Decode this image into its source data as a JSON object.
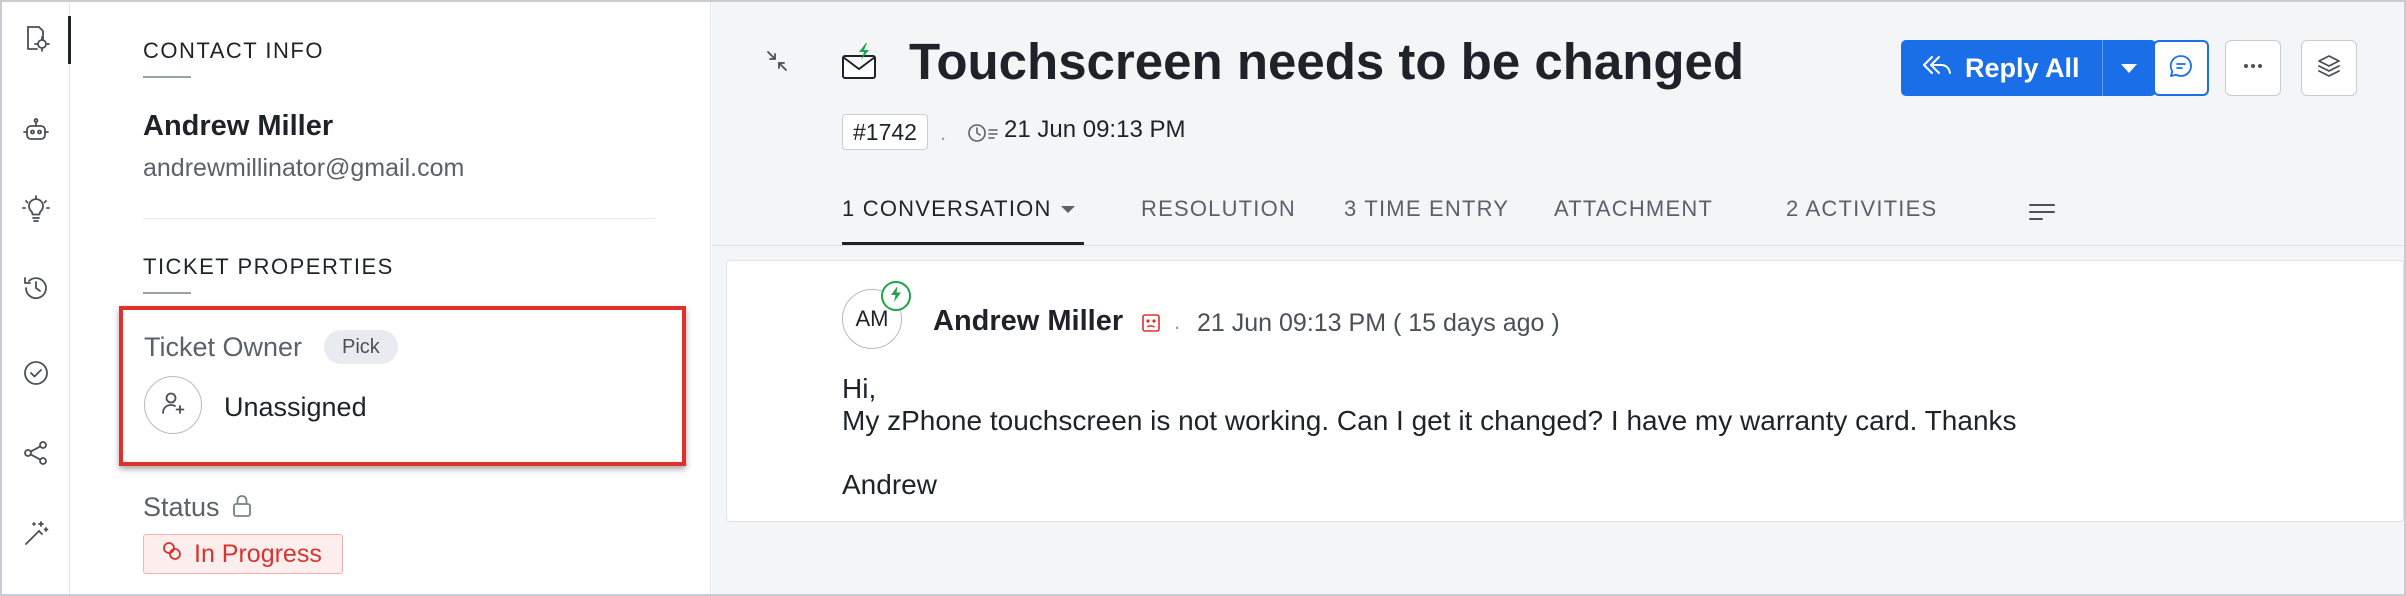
{
  "rail": {
    "items": [
      {
        "icon": "ticket-settings-icon"
      },
      {
        "icon": "bot-icon"
      },
      {
        "icon": "lightbulb-icon"
      },
      {
        "icon": "history-icon"
      },
      {
        "icon": "check-circle-icon"
      },
      {
        "icon": "share-icon"
      },
      {
        "icon": "magic-wand-icon"
      }
    ]
  },
  "contact": {
    "section_title": "CONTACT INFO",
    "name": "Andrew Miller",
    "email": "andrewmillinator@gmail.com"
  },
  "properties": {
    "section_title": "TICKET PROPERTIES",
    "owner_label": "Ticket Owner",
    "pick_label": "Pick",
    "owner_value": "Unassigned",
    "status_label": "Status",
    "status_value": "In Progress"
  },
  "ticket": {
    "title": "Touchscreen needs to be changed",
    "id": "#1742",
    "created": "21 Jun 09:13 PM",
    "separator": "."
  },
  "actions": {
    "reply_all": "Reply All"
  },
  "tabs": [
    {
      "label": "1 CONVERSATION",
      "active": true
    },
    {
      "label": "RESOLUTION"
    },
    {
      "label": "3 TIME ENTRY"
    },
    {
      "label": "ATTACHMENT"
    },
    {
      "label": "2 ACTIVITIES"
    }
  ],
  "thread": {
    "avatar_initials": "AM",
    "sender": "Andrew Miller",
    "separator": ".",
    "time": "21 Jun 09:13 PM ( 15 days ago )",
    "message_lines": [
      "Hi,",
      "My zPhone touchscreen is not working. Can I get it changed? I have my warranty card. Thanks",
      "",
      "Andrew"
    ]
  },
  "colors": {
    "primary": "#1a6fe8",
    "status": "#d8342f",
    "highlight": "#e0302c",
    "online_badge": "#1fa34a"
  }
}
